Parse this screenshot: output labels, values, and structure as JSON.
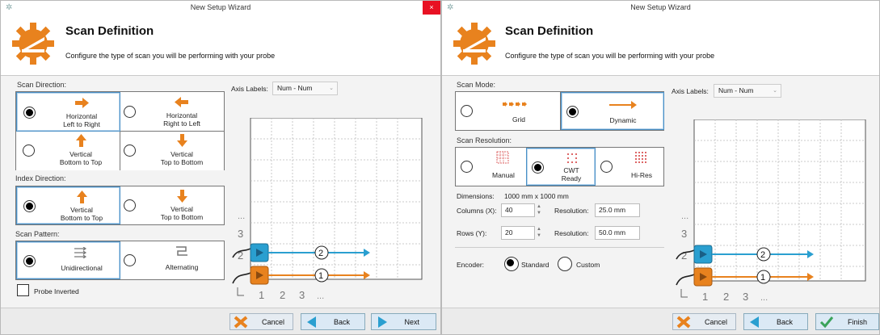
{
  "colors": {
    "accent_orange": "#e8821e",
    "accent_blue": "#2a9fd0",
    "selection_blue": "#4a90c6",
    "close_red": "#e81123"
  },
  "left": {
    "window_title": "New Setup Wizard",
    "close_symbol": "×",
    "header": {
      "title": "Scan Definition",
      "subtitle": "Configure the type of scan you will be performing with your probe"
    },
    "scan_direction": {
      "label": "Scan Direction:",
      "options": [
        {
          "line1": "Horizontal",
          "line2": "Left to Right",
          "icon": "arrow-right-icon",
          "selected": true
        },
        {
          "line1": "Horizontal",
          "line2": "Right to Left",
          "icon": "arrow-left-icon",
          "selected": false
        },
        {
          "line1": "Vertical",
          "line2": "Bottom to Top",
          "icon": "arrow-up-icon",
          "selected": false
        },
        {
          "line1": "Vertical",
          "line2": "Top to Bottom",
          "icon": "arrow-down-icon",
          "selected": false
        }
      ]
    },
    "index_direction": {
      "label": "Index Direction:",
      "options": [
        {
          "line1": "Vertical",
          "line2": "Bottom to Top",
          "icon": "arrow-up-icon",
          "selected": true
        },
        {
          "line1": "Vertical",
          "line2": "Top to Bottom",
          "icon": "arrow-down-icon",
          "selected": false
        }
      ]
    },
    "scan_pattern": {
      "label": "Scan Pattern:",
      "options": [
        {
          "label": "Unidirectional",
          "icon": "unidirectional-icon",
          "selected": true
        },
        {
          "label": "Alternating",
          "icon": "alternating-icon",
          "selected": false
        }
      ]
    },
    "probe_inverted": {
      "label": "Probe Inverted",
      "checked": false
    },
    "axis_labels": {
      "label": "Axis Labels:",
      "value": "Num - Num"
    },
    "diagram": {
      "row_labels": [
        "...",
        "3",
        "2"
      ],
      "col_labels": [
        "1",
        "2",
        "3",
        "..."
      ],
      "probe_numbers": [
        "2",
        "1"
      ]
    },
    "buttons": {
      "cancel": "Cancel",
      "back": "Back",
      "next": "Next"
    }
  },
  "right": {
    "window_title": "New Setup Wizard",
    "header": {
      "title": "Scan Definition",
      "subtitle": "Configure the type of scan you will be performing with your probe"
    },
    "scan_mode": {
      "label": "Scan Mode:",
      "options": [
        {
          "label": "Grid",
          "icon": "grid-arrows-icon",
          "selected": false
        },
        {
          "label": "Dynamic",
          "icon": "dynamic-arrow-icon",
          "selected": true
        }
      ]
    },
    "scan_resolution": {
      "label": "Scan Resolution:",
      "options": [
        {
          "line1": "Manual",
          "line2": "",
          "icon": "manual-grid-icon",
          "selected": false
        },
        {
          "line1": "CWT",
          "line2": "Ready",
          "icon": "cwt-grid-icon",
          "selected": true
        },
        {
          "line1": "Hi-Res",
          "line2": "",
          "icon": "hires-grid-icon",
          "selected": false
        }
      ]
    },
    "dimensions": {
      "label": "Dimensions:",
      "value": "1000 mm x 1000 mm"
    },
    "columns": {
      "label": "Columns (X):",
      "value": "40",
      "res_label": "Resolution:",
      "res_value": "25.0 mm"
    },
    "rows": {
      "label": "Rows (Y):",
      "value": "20",
      "res_label": "Resolution:",
      "res_value": "50.0 mm"
    },
    "encoder": {
      "label": "Encoder:",
      "options": [
        {
          "label": "Standard",
          "selected": true
        },
        {
          "label": "Custom",
          "selected": false
        }
      ]
    },
    "axis_labels": {
      "label": "Axis Labels:",
      "value": "Num - Num"
    },
    "diagram": {
      "row_labels": [
        "...",
        "3",
        "2"
      ],
      "col_labels": [
        "1",
        "2",
        "3",
        "..."
      ],
      "probe_numbers": [
        "2",
        "1"
      ]
    },
    "buttons": {
      "cancel": "Cancel",
      "back": "Back",
      "finish": "Finish"
    }
  }
}
